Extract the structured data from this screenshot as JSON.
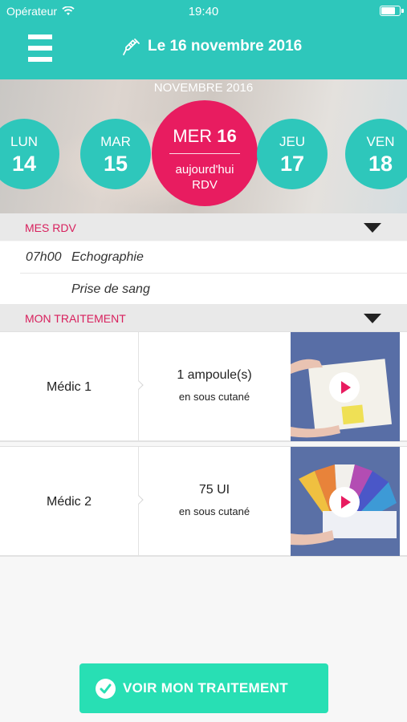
{
  "status_bar": {
    "carrier": "Opérateur",
    "time": "19:40",
    "battery_level": 0.85
  },
  "header": {
    "title": "Le 16 novembre 2016",
    "menu_icon": "hamburger-menu-icon",
    "title_icon": "syringe-icon"
  },
  "calendar": {
    "month": "NOVEMBRE 2016",
    "days": [
      {
        "name": "LUN",
        "number": "14"
      },
      {
        "name": "MAR",
        "number": "15"
      },
      {
        "name": "JEU",
        "number": "17"
      },
      {
        "name": "VEN",
        "number": "18"
      }
    ],
    "today": {
      "name": "MER",
      "number": "16",
      "subtitle_line1": "aujourd'hui",
      "subtitle_line2": "RDV"
    }
  },
  "appointments": {
    "title": "MES RDV",
    "items": [
      {
        "time": "07h00",
        "label": "Echographie"
      },
      {
        "time": "",
        "label": "Prise de sang"
      }
    ]
  },
  "treatment": {
    "title": "MON TRAITEMENT",
    "items": [
      {
        "name": "Médic 1",
        "dose": "1 ampoule(s)",
        "route": "en sous cutané",
        "video_icon": "play-icon"
      },
      {
        "name": "Médic 2",
        "dose": "75 UI",
        "route": "en sous cutané",
        "video_icon": "play-icon"
      }
    ]
  },
  "cta": {
    "label": "VOIR MON TRAITEMENT",
    "icon": "check-circle-icon"
  },
  "colors": {
    "teal": "#2ec7bb",
    "pink": "#e81c60",
    "cta_green": "#28dfb4",
    "section_bg": "#e9e9e9"
  }
}
